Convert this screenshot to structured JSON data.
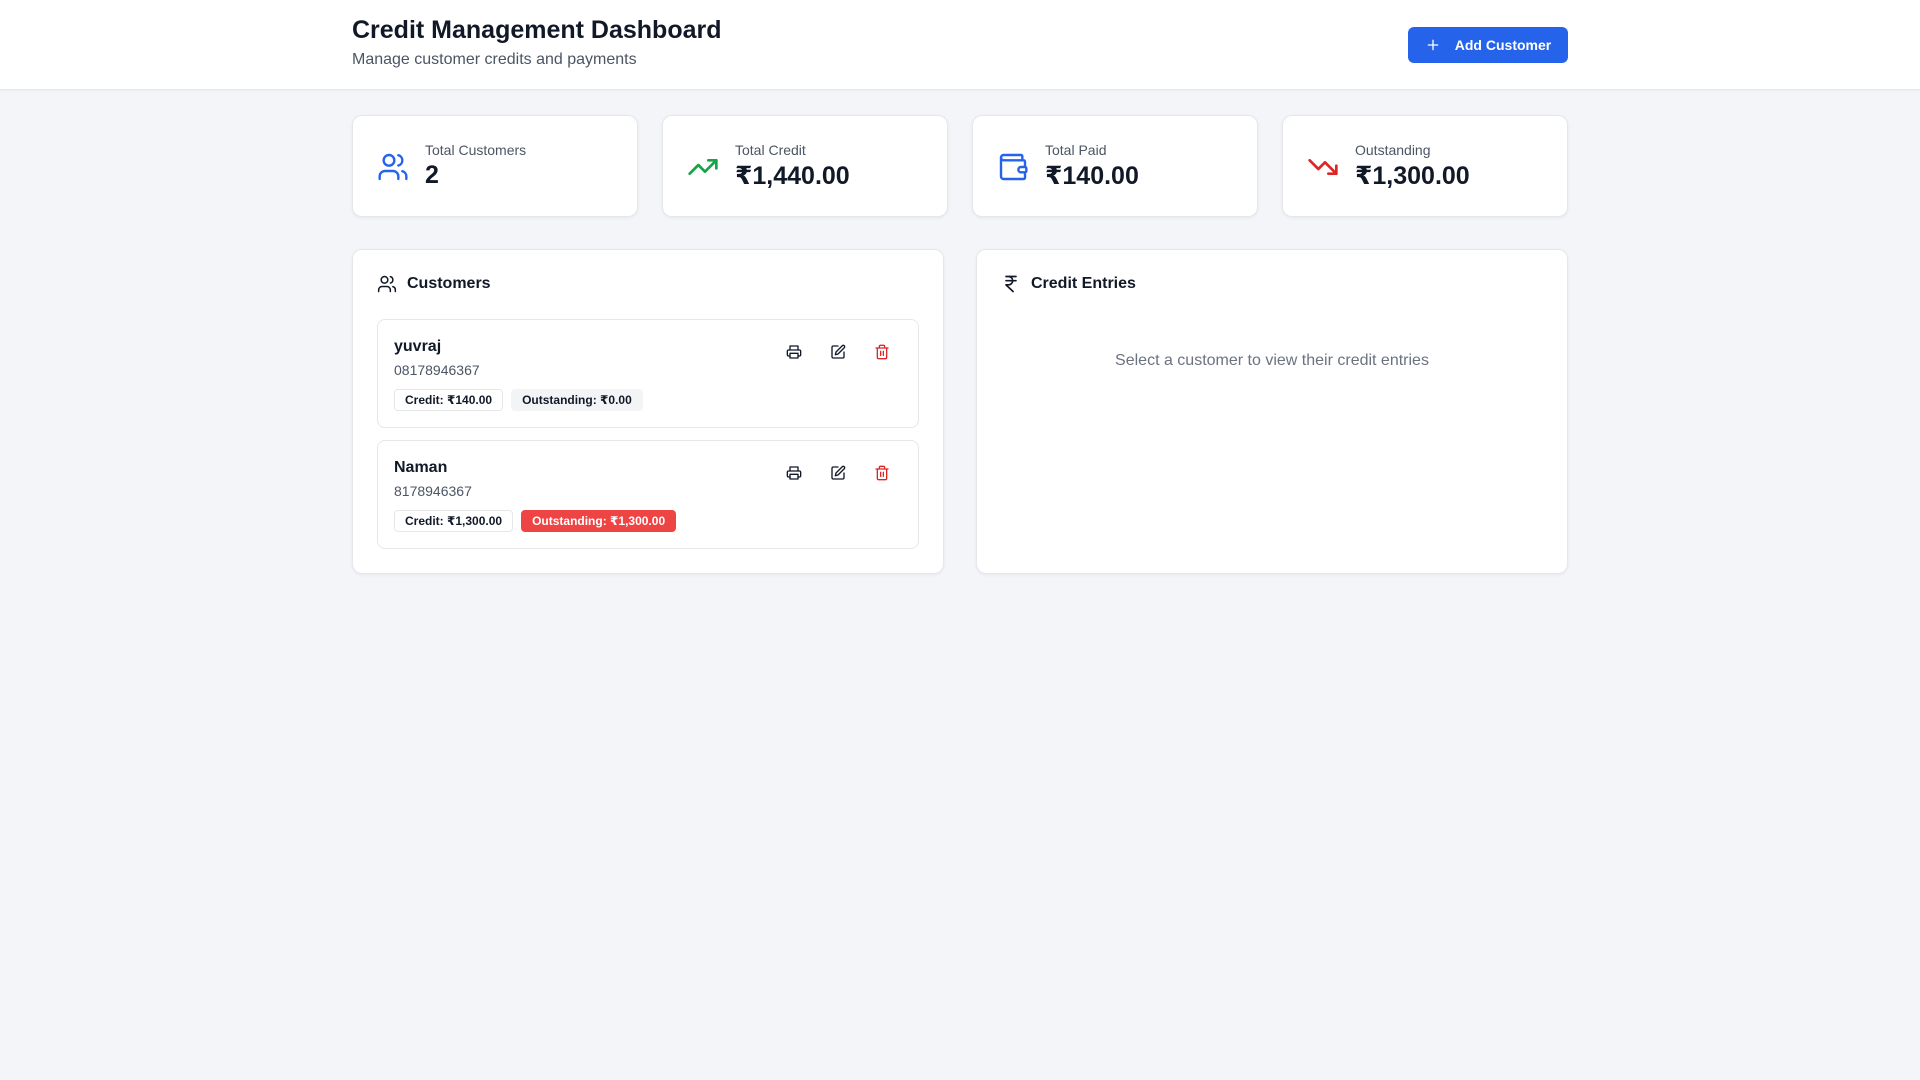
{
  "header": {
    "title": "Credit Management Dashboard",
    "subtitle": "Manage customer credits and payments",
    "add_button_label": "Add Customer",
    "accent_color": "#2563eb"
  },
  "stats": [
    {
      "label": "Total Customers",
      "value": "2",
      "icon": "users-icon"
    },
    {
      "label": "Total Credit",
      "value": "₹1,440.00",
      "icon": "trending-up-icon"
    },
    {
      "label": "Total Paid",
      "value": "₹140.00",
      "icon": "wallet-icon"
    },
    {
      "label": "Outstanding",
      "value": "₹1,300.00",
      "icon": "trending-down-icon"
    }
  ],
  "customers_panel": {
    "title": "Customers",
    "items": [
      {
        "name": "yuvraj",
        "phone": "08178946367",
        "credit": "Credit: ₹140.00",
        "outstanding": "Outstanding: ₹0.00",
        "outstanding_status": "zero"
      },
      {
        "name": "Naman",
        "phone": "8178946367",
        "credit": "Credit: ₹1,300.00",
        "outstanding": "Outstanding: ₹1,300.00",
        "outstanding_status": "due"
      }
    ]
  },
  "entries_panel": {
    "title": "Credit Entries",
    "empty_message": "Select a customer to view their credit entries"
  }
}
